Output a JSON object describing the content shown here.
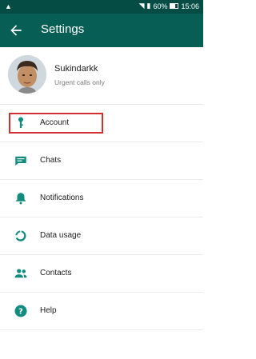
{
  "status_bar": {
    "battery": "60%",
    "time": "15:06"
  },
  "toolbar": {
    "title": "Settings"
  },
  "profile": {
    "name": "Sukindarkk",
    "status": "Urgent calls only"
  },
  "menu": {
    "items": [
      {
        "label": "Account",
        "icon": "key-icon"
      },
      {
        "label": "Chats",
        "icon": "chat-icon"
      },
      {
        "label": "Notifications",
        "icon": "bell-icon"
      },
      {
        "label": "Data usage",
        "icon": "data-usage-icon"
      },
      {
        "label": "Contacts",
        "icon": "contacts-icon"
      },
      {
        "label": "Help",
        "icon": "help-icon"
      }
    ]
  },
  "colors": {
    "primary": "#075e54",
    "status_bar": "#054d44",
    "icon": "#128c7e",
    "highlight": "#d32f2f"
  }
}
